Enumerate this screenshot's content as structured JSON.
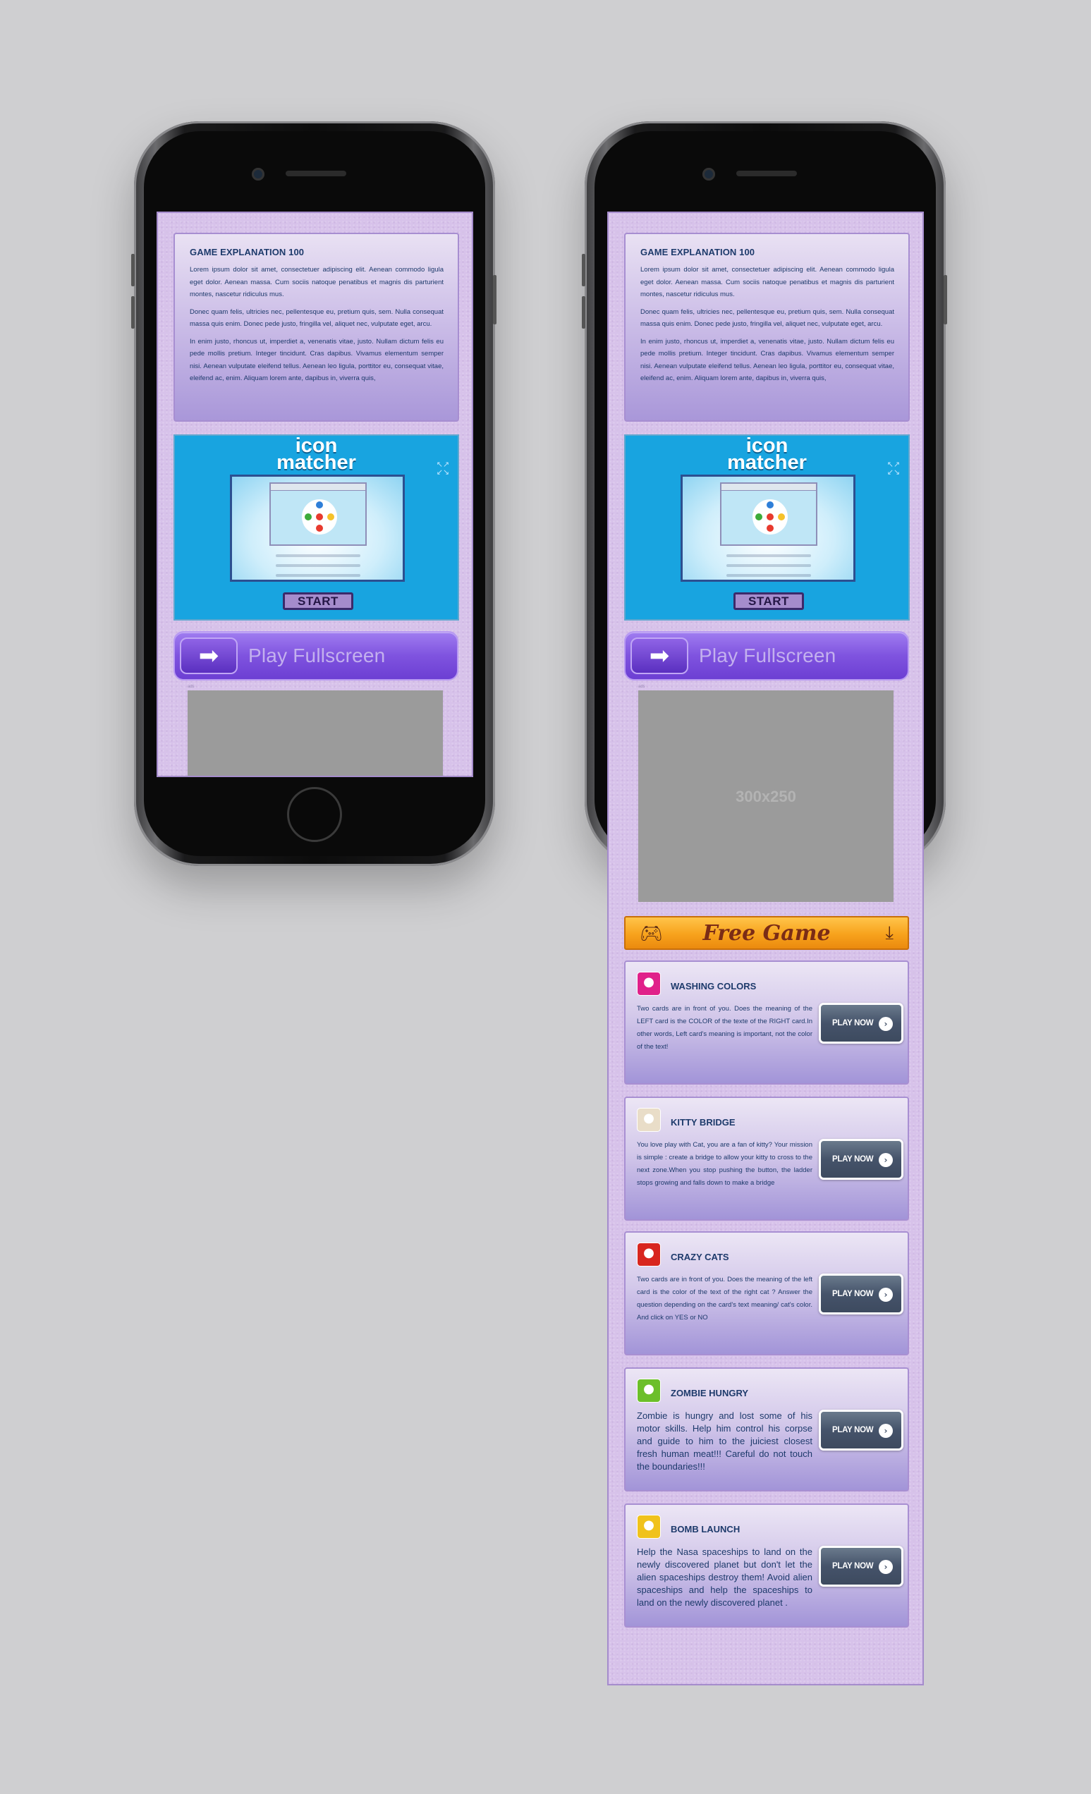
{
  "explanation": {
    "title": "GAME EXPLANATION 100",
    "p1": "Lorem ipsum dolor sit amet, consectetuer adipiscing elit. Aenean commodo ligula eget dolor. Aenean massa. Cum sociis natoque penatibus et magnis dis parturient montes, nascetur ridiculus mus.",
    "p2": "Donec quam felis, ultricies nec, pellentesque eu, pretium quis, sem. Nulla consequat massa quis enim. Donec pede justo, fringilla vel, aliquet nec, vulputate eget, arcu.",
    "p3": "In enim justo, rhoncus ut, imperdiet a, venenatis vitae, justo. Nullam dictum felis eu pede mollis pretium. Integer tincidunt. Cras dapibus. Vivamus elementum semper nisi. Aenean vulputate eleifend tellus. Aenean leo ligula, porttitor eu, consequat vitae, eleifend ac, enim. Aliquam lorem ante, dapibus in, viverra quis,"
  },
  "game_frame": {
    "logo_line1": "icon",
    "logo_line2": "matcher",
    "start_label": "START",
    "fullscreen_icon": "expand-arrows-icon",
    "dot_colors": [
      "#2f7fd8",
      "#e83a2e",
      "#f5c22a",
      "#3cab3a",
      "#e83a2e",
      "#e83a2e"
    ]
  },
  "play_fullscreen": {
    "label": "Play Fullscreen",
    "icon": "arrow-right-icon"
  },
  "ad": {
    "tag": "ads",
    "label": "300x250"
  },
  "free_game": {
    "label": "Free Game",
    "left_icon": "gamepad-icon",
    "right_icon": "download-icon"
  },
  "games": [
    {
      "title": "WASHING COLORS",
      "desc": "Two cards are in front of you. Does the meaning of the LEFT card is the COLOR of the texte of the RIGHT card.In other words, Left card's meaning is important, not the color of the text!",
      "button": "PLAY NOW",
      "icon_color": "#e0218a"
    },
    {
      "title": "KITTY BRIDGE",
      "desc": "You love play with Cat, you are a fan of kitty? Your mission is simple : create a bridge to allow your kitty to cross to the next zone.When you stop pushing the button, the ladder stops growing and falls down to make a bridge",
      "button": "PLAY NOW",
      "icon_color": "#e9ddc8"
    },
    {
      "title": "CRAZY CATS",
      "desc": "Two cards are in front of you. Does the meaning of the left card is the color of the text of the right cat ? Answer the question depending on the card's text meaning/ cat's color. And click on YES or NO",
      "button": "PLAY NOW",
      "icon_color": "#d8261f"
    },
    {
      "title": "ZOMBIE HUNGRY",
      "desc": "Zombie is hungry and lost some of his motor skills. Help him control his corpse and guide to him to the juiciest closest fresh human meat!!! Careful do not touch the boundaries!!!",
      "button": "PLAY NOW",
      "icon_color": "#6cbf2a"
    },
    {
      "title": "BOMB LAUNCH",
      "desc": "Help the Nasa spaceships to land on the newly discovered planet but don't let the alien spaceships destroy them! Avoid alien spaceships and help the spaceships to land on the newly discovered planet .",
      "button": "PLAY NOW",
      "icon_color": "#f0c21c"
    }
  ]
}
